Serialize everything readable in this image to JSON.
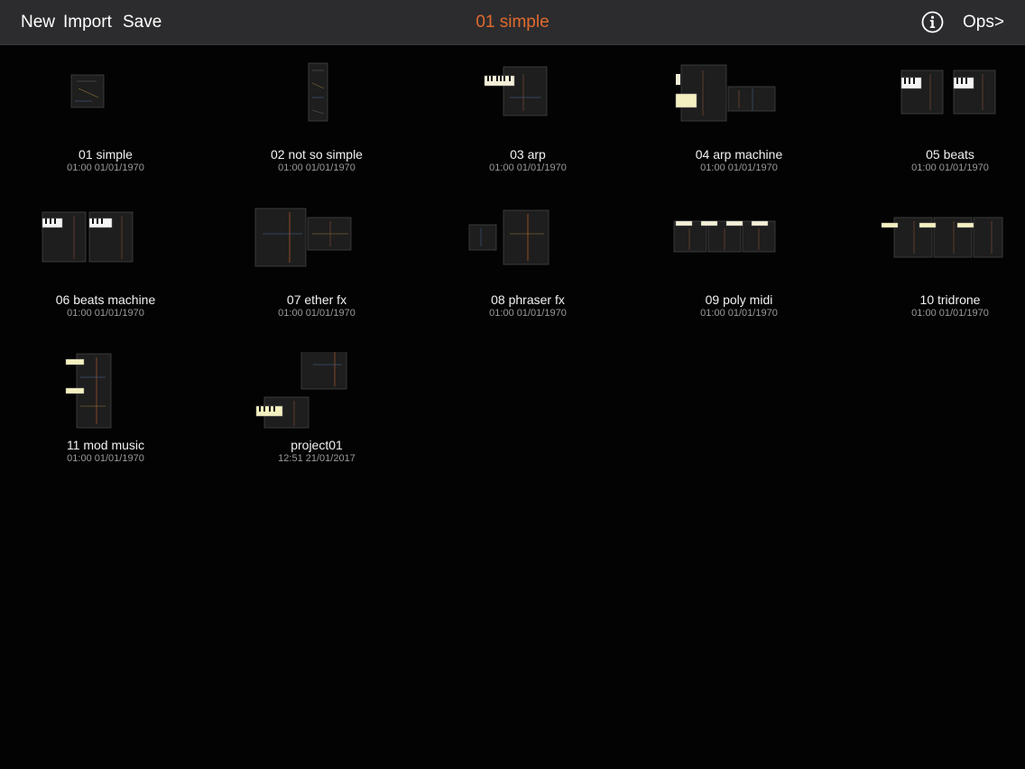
{
  "toolbar": {
    "new_label": "New",
    "import_label": "Import",
    "save_label": "Save",
    "title": "01 simple",
    "info_icon": "info-circle-icon",
    "ops_label": "Ops>"
  },
  "colors": {
    "title_accent": "#e06a2e",
    "background": "#030303",
    "toolbar_bg": "#2c2c2e"
  },
  "projects": [
    {
      "name": "01 simple",
      "date": "01:00 01/01/1970"
    },
    {
      "name": "02 not so simple",
      "date": "01:00 01/01/1970"
    },
    {
      "name": "03 arp",
      "date": "01:00 01/01/1970"
    },
    {
      "name": "04 arp machine",
      "date": "01:00 01/01/1970"
    },
    {
      "name": "05 beats",
      "date": "01:00 01/01/1970"
    },
    {
      "name": "06 beats machine",
      "date": "01:00 01/01/1970"
    },
    {
      "name": "07 ether fx",
      "date": "01:00 01/01/1970"
    },
    {
      "name": "08 phraser fx",
      "date": "01:00 01/01/1970"
    },
    {
      "name": "09 poly midi",
      "date": "01:00 01/01/1970"
    },
    {
      "name": "10 tridrone",
      "date": "01:00 01/01/1970"
    },
    {
      "name": "11 mod music",
      "date": "01:00 01/01/1970"
    },
    {
      "name": "project01",
      "date": "12:51 21/01/2017"
    }
  ]
}
